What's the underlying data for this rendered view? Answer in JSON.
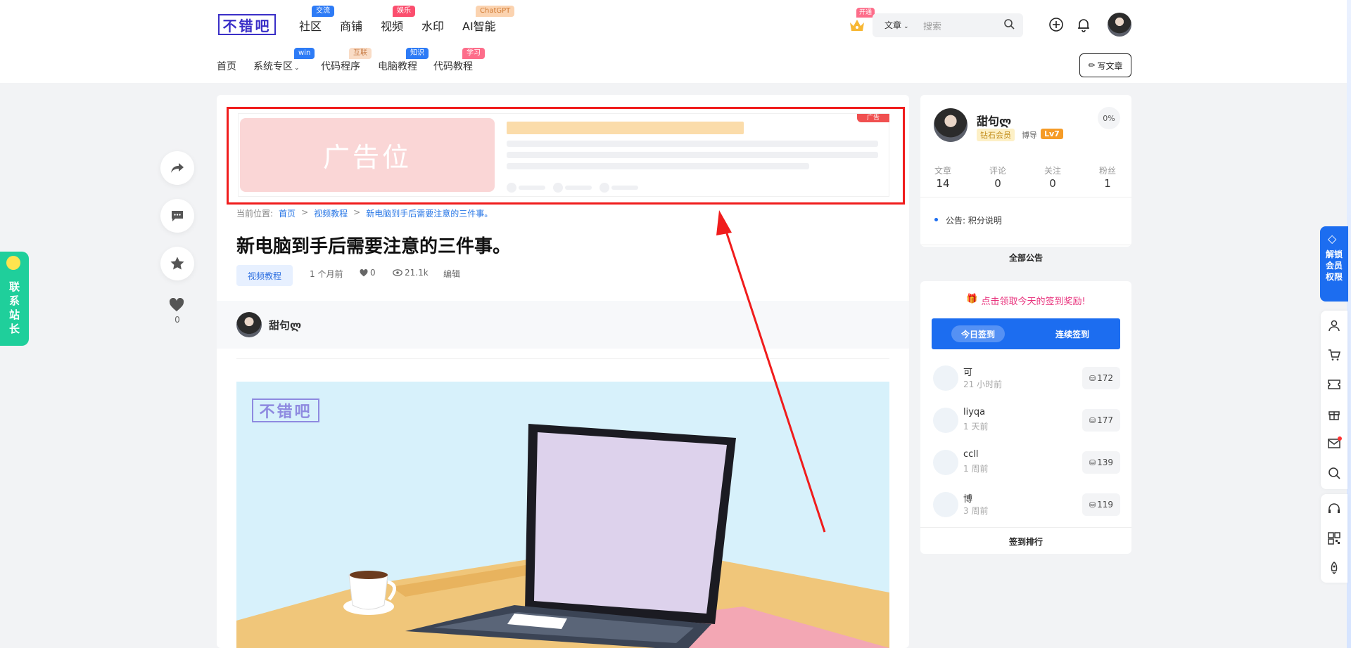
{
  "header": {
    "logo_text": "不错吧",
    "top_nav": [
      {
        "label": "社区",
        "badge": "交流"
      },
      {
        "label": "商铺",
        "badge": ""
      },
      {
        "label": "视频",
        "badge": "娱乐"
      },
      {
        "label": "水印",
        "badge": ""
      },
      {
        "label": "AI智能",
        "badge": "ChatGPT"
      }
    ],
    "sub_nav": [
      {
        "label": "首页",
        "badge": ""
      },
      {
        "label": "系统专区",
        "badge": "win"
      },
      {
        "label": "代码程序",
        "badge": "互联"
      },
      {
        "label": "电脑教程",
        "badge": "知识"
      },
      {
        "label": "代码教程",
        "badge": "学习"
      }
    ],
    "vip_badge": "开通",
    "search_select": "文章",
    "search_placeholder": "搜索",
    "write_label": "写文章"
  },
  "left_float": {
    "like_count": "0",
    "contact_label": [
      "联",
      "系",
      "站",
      "长"
    ]
  },
  "ad": {
    "placeholder_text": "广告位",
    "tag": "广告"
  },
  "article": {
    "breadcrumb_prefix": "当前位置:",
    "breadcrumb": [
      "首页",
      "视频教程",
      "新电脑到手后需要注意的三件事。"
    ],
    "title": "新电脑到手后需要注意的三件事。",
    "category": "视频教程",
    "time": "1 个月前",
    "likes": "0",
    "views": "21.1k",
    "edit_label": "编辑",
    "author": "甜句ლ",
    "image_watermark": "不错吧"
  },
  "profile": {
    "name": "甜句ლ",
    "vip": "钻石会员",
    "role": "博导",
    "level": "Lv7",
    "progress": "0%",
    "stats": [
      {
        "label": "文章",
        "value": "14"
      },
      {
        "label": "评论",
        "value": "0"
      },
      {
        "label": "关注",
        "value": "0"
      },
      {
        "label": "粉丝",
        "value": "1"
      }
    ],
    "notice": "公告: 积分说明",
    "all_notice": "全部公告"
  },
  "signin": {
    "prompt": "点击领取今天的签到奖励!",
    "today": "今日签到",
    "continuous": "连续签到",
    "rows": [
      {
        "name": "可",
        "time": "21 小时前",
        "points": "172"
      },
      {
        "name": "liyqa",
        "time": "1 天前",
        "points": "177"
      },
      {
        "name": "ccll",
        "time": "1 周前",
        "points": "139"
      },
      {
        "name": "博",
        "time": "3 周前",
        "points": "119"
      }
    ],
    "rank_label": "签到排行"
  },
  "right_bar": {
    "unlock_label": [
      "解锁",
      "会员",
      "权限"
    ]
  },
  "colors": {
    "accent": "#1c6df0",
    "ad_highlight": "#f01c1c",
    "contact_green": "#1fcf9b"
  }
}
